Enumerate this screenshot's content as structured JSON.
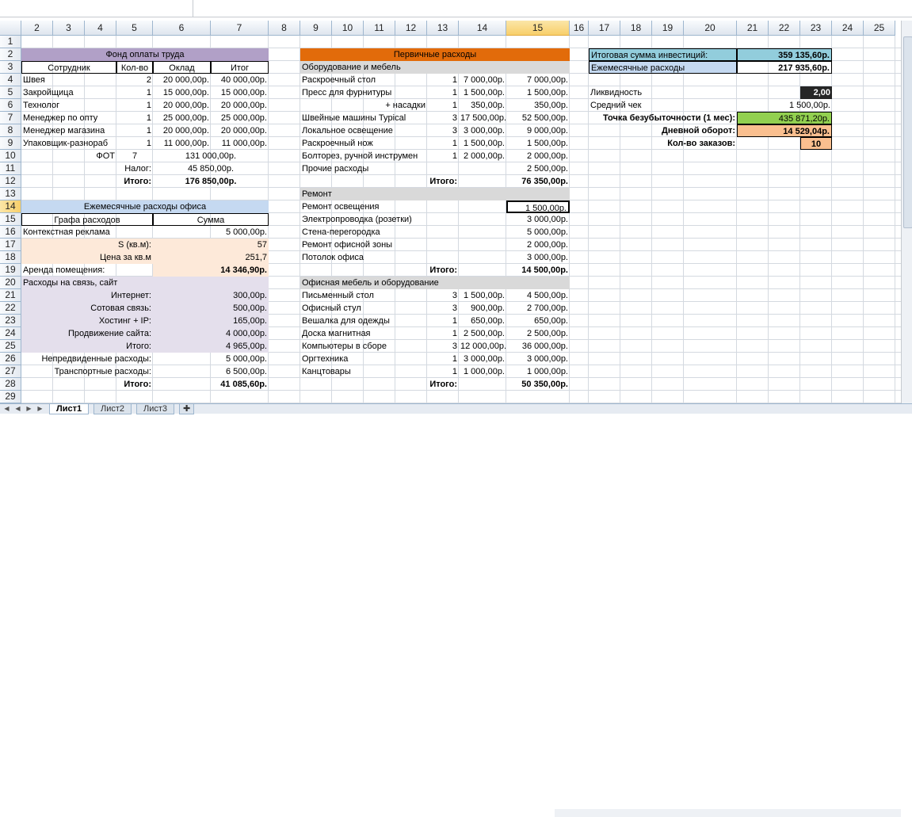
{
  "columns": [
    "2",
    "3",
    "4",
    "5",
    "6",
    "7",
    "8",
    "9",
    "10",
    "11",
    "12",
    "13",
    "14",
    "15",
    "16",
    "17",
    "18",
    "19",
    "20",
    "21",
    "22",
    "23",
    "24",
    "25"
  ],
  "rows": [
    "1",
    "2",
    "3",
    "4",
    "5",
    "6",
    "7",
    "8",
    "9",
    "10",
    "11",
    "12",
    "13",
    "14",
    "15",
    "16",
    "17",
    "18",
    "19",
    "20",
    "21",
    "22",
    "23",
    "24",
    "25",
    "26",
    "27",
    "28",
    "29"
  ],
  "selected_col": "15",
  "selected_row": "14",
  "payroll": {
    "title": "Фонд оплаты труда",
    "headers": [
      "Сотрудник",
      "Кол-во",
      "Оклад",
      "Итог"
    ],
    "rows": [
      [
        "Швея",
        "2",
        "20 000,00р.",
        "40 000,00р."
      ],
      [
        "Закройщица",
        "1",
        "15 000,00р.",
        "15 000,00р."
      ],
      [
        "Технолог",
        "1",
        "20 000,00р.",
        "20 000,00р."
      ],
      [
        "Менеджер по опту",
        "1",
        "25 000,00р.",
        "25 000,00р."
      ],
      [
        "Менеджер магазина",
        "1",
        "20 000,00р.",
        "20 000,00р."
      ],
      [
        "Упаковщик-разнораб",
        "1",
        "11 000,00р.",
        "11 000,00р."
      ]
    ],
    "fot_label": "ФОТ",
    "fot_count": "7",
    "fot_value": "131 000,00р.",
    "tax_label": "Налог:",
    "tax_value": "45 850,00р.",
    "total_label": "Итого:",
    "total_value": "176 850,00р."
  },
  "office": {
    "title": "Ежемесячные расходы офиса",
    "headers": [
      "Графа расходов",
      "Сумма"
    ],
    "ads_label": "Контекстная реклама",
    "ads_value": "5 000,00р.",
    "area_label": "S (кв.м):",
    "area_value": "57",
    "price_label": "Цена за кв.м",
    "price_value": "251,7",
    "rent_label": "Аренда помещения:",
    "rent_value": "14 346,90р.",
    "comm_label": "Расходы на связь, сайт",
    "comm_rows": [
      [
        "Интернет:",
        "300,00р."
      ],
      [
        "Сотовая связь:",
        "500,00р."
      ],
      [
        "Хостинг + IP:",
        "165,00р."
      ],
      [
        "Продвижение сайта:",
        "4 000,00р."
      ],
      [
        "Итого:",
        "4 965,00р."
      ]
    ],
    "unexpected_label": "Непредвиденные расходы:",
    "unexpected_value": "5 000,00р.",
    "transport_label": "Транспортные расходы:",
    "transport_value": "6 500,00р.",
    "total_label": "Итого:",
    "total_value": "41 085,60р."
  },
  "primary": {
    "title": "Первичные расходы",
    "equip_title": "Оборудование и мебель",
    "equip_rows": [
      [
        "Раскроечный стол",
        "1",
        "7 000,00р.",
        "7 000,00р."
      ],
      [
        "Пресс для фурнитуры",
        "1",
        "1 500,00р.",
        "1 500,00р."
      ],
      [
        "+ насадки",
        "1",
        "350,00р.",
        "350,00р."
      ],
      [
        "Швейные машины Typical",
        "3",
        "17 500,00р.",
        "52 500,00р."
      ],
      [
        "Локальное освещение",
        "3",
        "3 000,00р.",
        "9 000,00р."
      ],
      [
        "Раскроечный нож",
        "1",
        "1 500,00р.",
        "1 500,00р."
      ],
      [
        "Болторез, ручной инструмен",
        "1",
        "2 000,00р.",
        "2 000,00р."
      ],
      [
        "Прочие расходы",
        "",
        "",
        "2 500,00р."
      ]
    ],
    "equip_total_label": "Итого:",
    "equip_total_value": "76 350,00р.",
    "repair_title": "Ремонт",
    "repair_rows": [
      [
        "Ремонт освещения",
        "1 500,00р."
      ],
      [
        "Электропроводка (розетки)",
        "3 000,00р."
      ],
      [
        "Стена-перегородка",
        "5 000,00р."
      ],
      [
        "Ремонт офисной зоны",
        "2 000,00р."
      ],
      [
        "Потолок офиса",
        "3 000,00р."
      ]
    ],
    "repair_total_label": "Итого:",
    "repair_total_value": "14 500,00р.",
    "furn_title": "Офисная мебель и оборудование",
    "furn_rows": [
      [
        "Письменный стол",
        "3",
        "1 500,00р.",
        "4 500,00р."
      ],
      [
        "Офисный стул",
        "3",
        "900,00р.",
        "2 700,00р."
      ],
      [
        "Вешалка для одежды",
        "1",
        "650,00р.",
        "650,00р."
      ],
      [
        "Доска магнитная",
        "1",
        "2 500,00р.",
        "2 500,00р."
      ],
      [
        "Компьютеры в сборе",
        "3",
        "12 000,00р.",
        "36 000,00р."
      ],
      [
        "Оргтехника",
        "1",
        "3 000,00р.",
        "3 000,00р."
      ],
      [
        "Канцтовары",
        "1",
        "1 000,00р.",
        "1 000,00р."
      ]
    ],
    "furn_total_label": "Итого:",
    "furn_total_value": "50 350,00р."
  },
  "summary": {
    "invest_label": "Итоговая сумма инвестиций:",
    "invest_value": "359 135,60р.",
    "monthly_label": "Ежемесячные расходы",
    "monthly_value": "217 935,60р.",
    "liquidity_label": "Ликвидность",
    "liquidity_value": "2,00",
    "avg_check_label": "Средний чек",
    "avg_check_value": "1 500,00р.",
    "breakeven_label": "Точка безубыточности (1 мес):",
    "breakeven_value": "435 871,20р.",
    "daily_label": "Дневной оборот:",
    "daily_value": "14 529,04р.",
    "orders_label": "Кол-во заказов:",
    "orders_value": "10"
  },
  "tabs": [
    "Лист1",
    "Лист2",
    "Лист3"
  ],
  "colors": {
    "purple": "#b1a0c7",
    "purple_light": "#e4dfec",
    "orange": "#e26b0a",
    "peach": "#fde9d9",
    "blue_light": "#c5d9f1",
    "gray": "#d9d9d9",
    "teal": "#92cddc",
    "green": "#92d050",
    "salmon": "#fabf8f",
    "dark": "#262626"
  }
}
